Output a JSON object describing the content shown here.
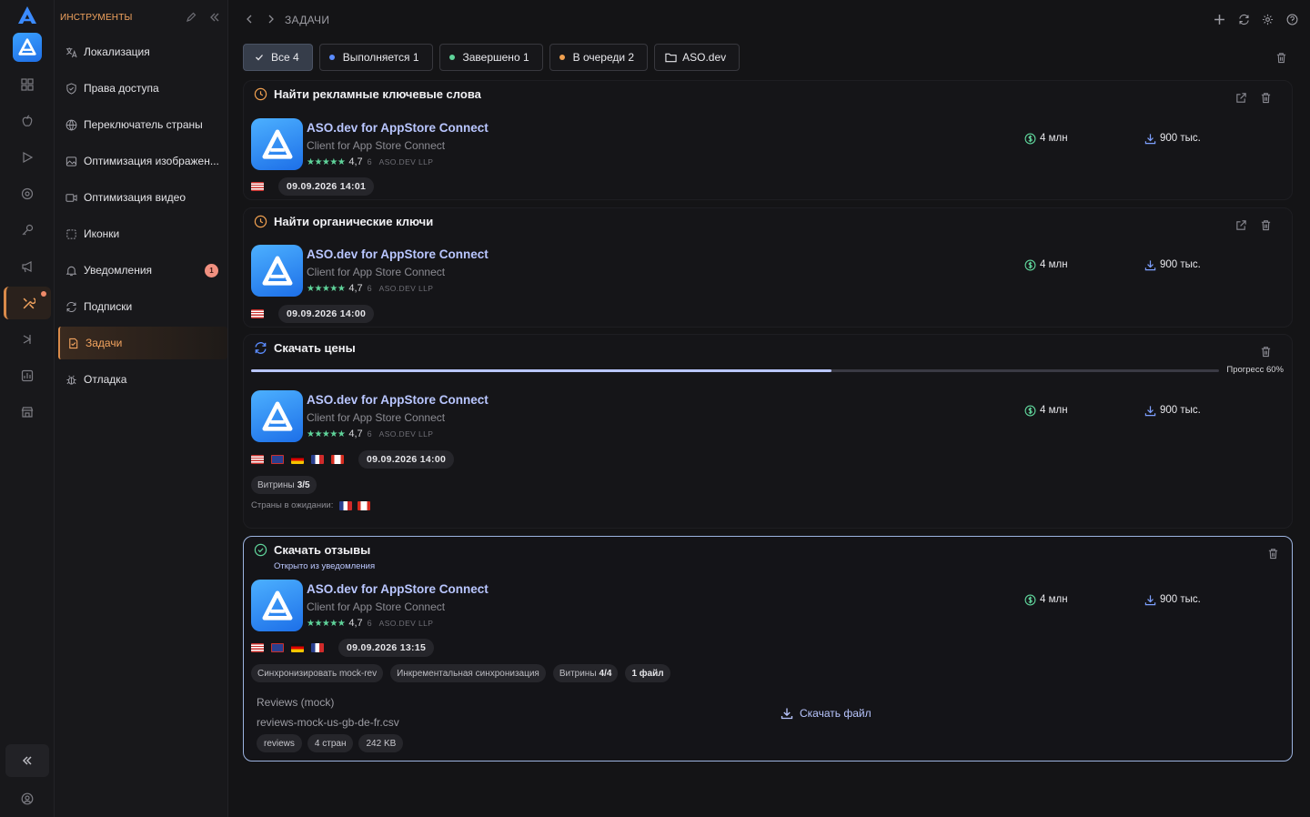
{
  "sidebar": {
    "header_title": "ИНСТРУМЕНТЫ",
    "items": [
      {
        "label": "Локализация",
        "icon": "translate-icon"
      },
      {
        "label": "Права доступа",
        "icon": "shield-icon"
      },
      {
        "label": "Переключатель страны",
        "icon": "globe-icon"
      },
      {
        "label": "Оптимизация изображен...",
        "icon": "image-icon"
      },
      {
        "label": "Оптимизация видео",
        "icon": "video-icon"
      },
      {
        "label": "Иконки",
        "icon": "frame-icon"
      },
      {
        "label": "Уведомления",
        "icon": "bell-icon",
        "badge": "1"
      },
      {
        "label": "Подписки",
        "icon": "refresh-icon"
      },
      {
        "label": "Задачи",
        "icon": "task-icon",
        "active": true
      },
      {
        "label": "Отладка",
        "icon": "bug-icon"
      }
    ]
  },
  "topbar": {
    "breadcrumb": "ЗАДАЧИ"
  },
  "filters": [
    {
      "label": "Все 4",
      "active": true,
      "icon": "check-icon"
    },
    {
      "label": "Выполняется 1",
      "dot": "#5b8cff"
    },
    {
      "label": "Завершено 1",
      "dot": "#5fd39a"
    },
    {
      "label": "В очереди 2",
      "dot": "#f0a050"
    },
    {
      "label": "ASO.dev",
      "icon": "folder-icon"
    }
  ],
  "app": {
    "name": "ASO.dev for AppStore Connect",
    "desc": "Client for App Store Connect",
    "stars": "★★★★★",
    "rating": "4,7",
    "rating_count": "6",
    "developer": "ASO.DEV LLP",
    "revenue": "4 млн",
    "downloads": "900 тыс."
  },
  "tasks": [
    {
      "title": "Найти рекламные ключевые слова",
      "date": "09.09.2026 14:01",
      "status": "queued"
    },
    {
      "title": "Найти органические ключи",
      "date": "09.09.2026 14:00",
      "status": "queued"
    },
    {
      "title": "Скачать цены",
      "date": "09.09.2026 14:00",
      "status": "running",
      "progress_label": "Прогресс 60%",
      "progress": 0.6,
      "storefronts_label": "Витрины",
      "storefronts_value": "3/5",
      "waiting_label": "Страны в ожидании:"
    },
    {
      "title": "Скачать отзывы",
      "note": "Открыто из уведомления",
      "date": "09.09.2026 13:15",
      "status": "done",
      "pills": [
        {
          "text": "Синхронизировать mock-rev"
        },
        {
          "text": "Инкрементальная синхронизация"
        },
        {
          "text": "Витрины",
          "bold": "4/4"
        },
        {
          "text": "",
          "bold": "1 файл"
        }
      ],
      "file": {
        "title": "Reviews (mock)",
        "name": "reviews-mock-us-gb-de-fr.csv",
        "tags": [
          "reviews",
          "4 стран",
          "242 KB"
        ],
        "download_label": "Скачать файл"
      }
    }
  ],
  "colors": {
    "accent": "#f3a45f",
    "link": "#b9c6ff",
    "star": "#5fd39a"
  }
}
